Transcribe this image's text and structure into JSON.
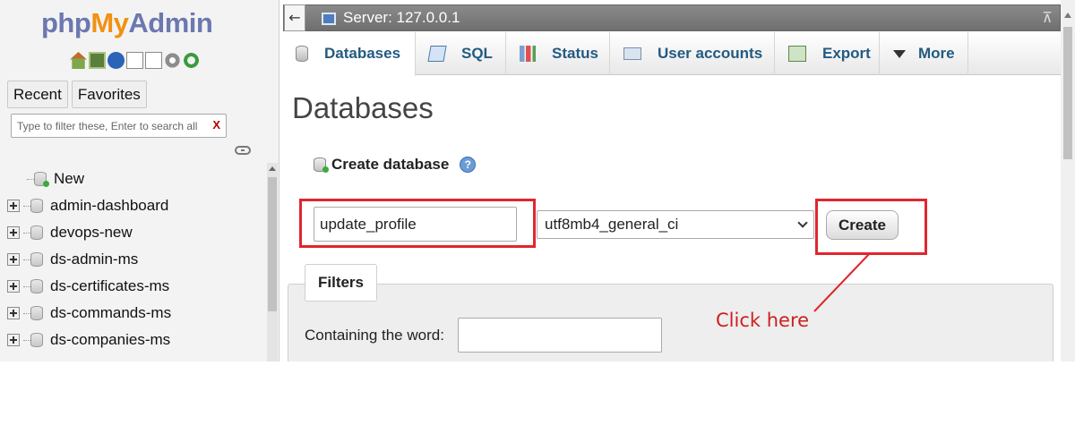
{
  "navigation": {
    "logo": {
      "php": "php",
      "my": "My",
      "admin": "Admin"
    },
    "icons": [
      "home-icon",
      "exit-icon",
      "help-icon",
      "docs-icon",
      "docs-icon",
      "settings-icon",
      "reload-icon"
    ],
    "tabs": [
      {
        "label": "Recent"
      },
      {
        "label": "Favorites"
      }
    ],
    "filter": {
      "placeholder": "Type to filter these, Enter to search all",
      "clear_label": "X"
    },
    "tree": [
      {
        "label": "New"
      },
      {
        "label": "admin-dashboard"
      },
      {
        "label": "devops-new"
      },
      {
        "label": "ds-admin-ms"
      },
      {
        "label": "ds-certificates-ms"
      },
      {
        "label": "ds-commands-ms"
      },
      {
        "label": "ds-companies-ms"
      }
    ]
  },
  "serverbar": {
    "collapse": "←",
    "label": "Server: 127.0.0.1",
    "right": "⊼"
  },
  "tabs": [
    {
      "label": "Databases",
      "icon": "database-icon"
    },
    {
      "label": "SQL",
      "icon": "sql-icon"
    },
    {
      "label": "Status",
      "icon": "status-icon"
    },
    {
      "label": "User accounts",
      "icon": "user-accounts-icon"
    },
    {
      "label": "Export",
      "icon": "export-icon"
    },
    {
      "label": "More",
      "icon": "caret-down-icon"
    }
  ],
  "page": {
    "title": "Databases",
    "create_heading": "Create database",
    "help_glyph": "?",
    "db_name_value": "update_profile",
    "collation_value": "utf8mb4_general_ci",
    "create_label": "Create",
    "annotation": "Click here",
    "filters_label": "Filters",
    "containing_label": "Containing the word:"
  },
  "colors": {
    "annotation": "#e0262e",
    "link": "#235a81",
    "serverbar": "#7a7a7a"
  }
}
